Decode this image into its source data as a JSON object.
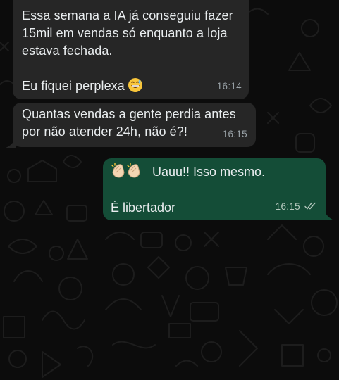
{
  "messages": [
    {
      "direction": "incoming",
      "text": "Essa semana a IA já conseguiu fazer\n15mil em vendas só enquanto a loja\nestava fechada.\n\nEu fiquei perplexa",
      "emoji": "grinning-sweat-emoji",
      "time": "16:14"
    },
    {
      "direction": "incoming",
      "text": "Quantas vendas a gente perdia antes\npor não atender 24h, não é?!",
      "time": "16:15"
    },
    {
      "direction": "outgoing",
      "emoji": "clapping-hands-emoji",
      "line1": "Uauu!! Isso mesmo.",
      "line2": "É libertador",
      "time": "16:15",
      "status": "double-check-read-icon"
    }
  ],
  "colors": {
    "background": "#0c0c0c",
    "incoming_bubble": "#262626",
    "outgoing_bubble": "#144d37",
    "text": "#e9edef",
    "doodle": "#1c1c1c"
  }
}
